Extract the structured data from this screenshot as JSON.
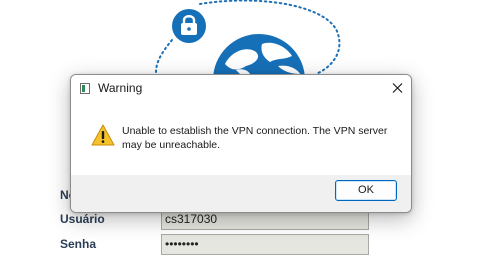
{
  "background_app": {
    "labels": {
      "partial_label": "No",
      "usuario": "Usuário",
      "senha": "Senha"
    },
    "fields": {
      "usuario_value": "cs317030",
      "senha_value": "••••••••"
    },
    "icons": {
      "lock_badge": "lock-icon",
      "globe": "globe-icon"
    },
    "colors": {
      "brand_blue": "#1670b8",
      "label_text": "#2c3e57",
      "dotted_orbit": "#1f6fb5"
    }
  },
  "dialog": {
    "title": "Warning",
    "message": "Unable to establish the VPN connection. The VPN server may be unreachable.",
    "ok_label": "OK",
    "icons": {
      "app": "app-window-icon",
      "close": "close-icon",
      "warning": "warning-icon"
    },
    "colors": {
      "warning_yellow": "#f6c12b",
      "button_border": "#0067c0",
      "footer_bg": "#f0f0f0"
    }
  }
}
